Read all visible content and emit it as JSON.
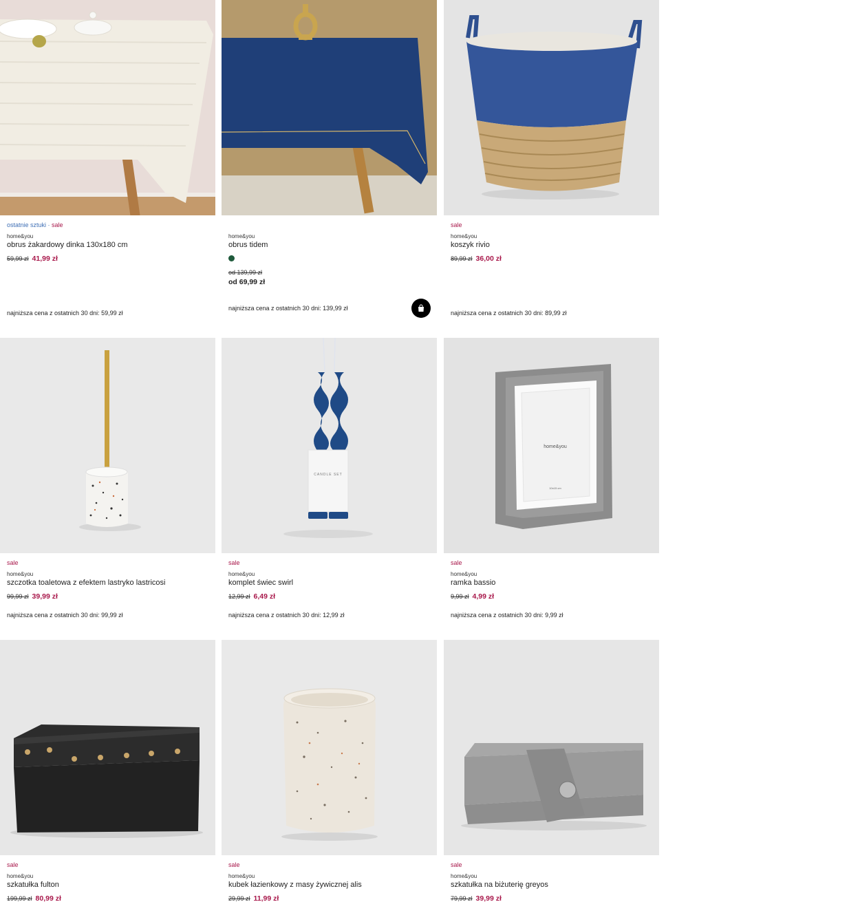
{
  "products": [
    {
      "tags": [
        {
          "text": "ostatnie sztuki",
          "color": "#3f6fb5"
        },
        {
          "text": " · ",
          "color": "#3f6fb5"
        },
        {
          "text": "sale",
          "color": "#a8174a"
        }
      ],
      "brand": "home&you",
      "title": "obrus żakardowy dinka 130x180 cm",
      "old_price": "59,99 zł",
      "new_price": "41,99 zł",
      "lowest": "najniższa cena z ostatnich 30 dni: 59,99 zł",
      "image": "white-jacquard-tablecloth"
    },
    {
      "tags": [],
      "brand": "home&you",
      "title": "obrus tidem",
      "swatch_color": "#1f5a3c",
      "old_price": "od 139,99 zł",
      "new_price": "od 69,99 zł",
      "lowest": "najniższa cena z ostatnich 30 dni: 139,99 zł",
      "cart_icon": "shopping-bag-icon",
      "image": "navy-tablecloth"
    },
    {
      "tags": [
        {
          "text": "sale",
          "color": "#a8174a"
        }
      ],
      "brand": "home&you",
      "title": "koszyk rivio",
      "old_price": "89,99 zł",
      "new_price": "36,00 zł",
      "lowest": "najniższa cena z ostatnich 30 dni: 89,99 zł",
      "image": "jute-basket"
    },
    {
      "tags": [
        {
          "text": "sale",
          "color": "#a8174a"
        }
      ],
      "brand": "home&you",
      "title": "szczotka toaletowa z efektem lastryko lastricosi",
      "old_price": "99,99 zł",
      "new_price": "39,99 zł",
      "lowest": "najniższa cena z ostatnich 30 dni: 99,99 zł",
      "image": "terrazzo-toilet-brush"
    },
    {
      "tags": [
        {
          "text": "sale",
          "color": "#a8174a"
        }
      ],
      "brand": "home&you",
      "title": "komplet świec swirl",
      "old_price": "12,99 zł",
      "new_price": "6,49 zł",
      "lowest": "najniższa cena z ostatnich 30 dni: 12,99 zł",
      "image": "swirl-candles",
      "packaging_text": "CANDLE SET"
    },
    {
      "tags": [
        {
          "text": "sale",
          "color": "#a8174a"
        }
      ],
      "brand": "home&you",
      "title": "ramka bassio",
      "old_price": "9,99 zł",
      "new_price": "4,99 zł",
      "lowest": "najniższa cena z ostatnich 30 dni: 9,99 zł",
      "image": "grey-photo-frame",
      "frame_logo": "home&you",
      "frame_size": "10x15 cm"
    },
    {
      "tags": [
        {
          "text": "sale",
          "color": "#a8174a"
        }
      ],
      "brand": "home&you",
      "title": "szkatułka fulton",
      "old_price": "199,99 zł",
      "new_price": "80,99 zł",
      "image": "black-studded-box"
    },
    {
      "tags": [
        {
          "text": "sale",
          "color": "#a8174a"
        }
      ],
      "brand": "home&you",
      "title": "kubek łazienkowy z masy żywicznej alis",
      "old_price": "29,99 zł",
      "new_price": "11,99 zł",
      "image": "terrazzo-cup"
    },
    {
      "tags": [
        {
          "text": "sale",
          "color": "#a8174a"
        }
      ],
      "brand": "home&you",
      "title": "szkatułka na biżuterię greyos",
      "old_price": "79,99 zł",
      "new_price": "39,99 zł",
      "image": "grey-jewelry-box"
    }
  ]
}
